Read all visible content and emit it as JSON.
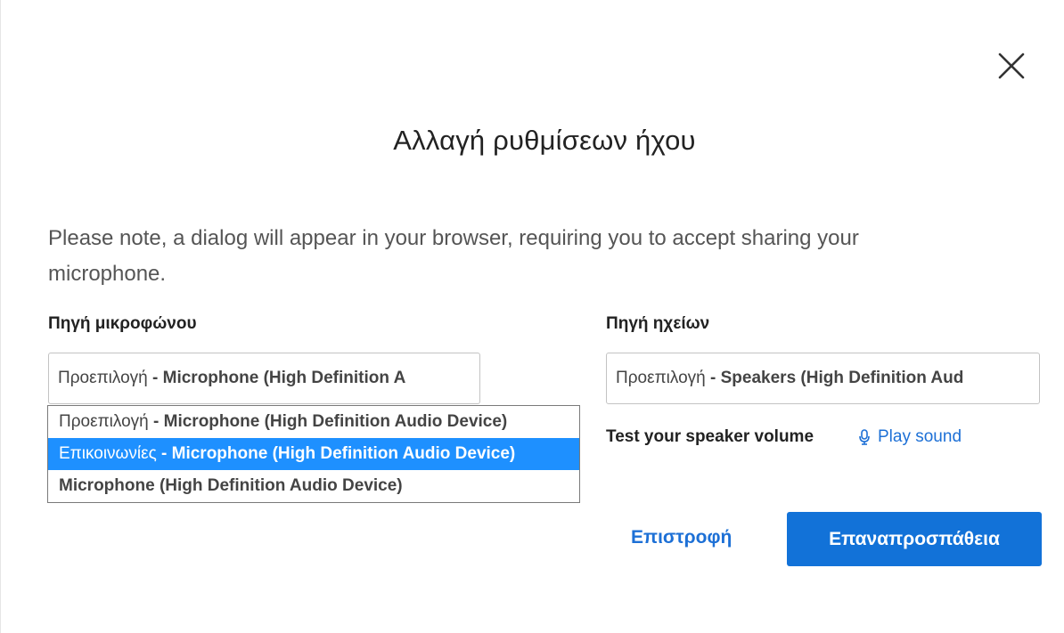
{
  "dialog": {
    "title": "Αλλαγή ρυθμίσεων ήχου",
    "note": "Please note, a dialog will appear in your browser, requiring you to accept sharing your microphone."
  },
  "microphone": {
    "label": "Πηγή μικροφώνου",
    "selected_prefix": "Προεπιλογή",
    "selected_device": " - Microphone (High Definition A",
    "options": [
      {
        "prefix": "Προεπιλογή",
        "device": " - Microphone (High Definition Audio Device)"
      },
      {
        "prefix": "Επικοινωνίες",
        "device": " - Microphone (High Definition Audio Device)"
      },
      {
        "prefix": "",
        "device": "Microphone (High Definition Audio Device)"
      }
    ]
  },
  "speaker": {
    "label": "Πηγή ηχείων",
    "selected_prefix": "Προεπιλογή",
    "selected_device": " - Speakers (High Definition Aud",
    "test_label": "Test your speaker volume",
    "play_label": "Play sound"
  },
  "actions": {
    "back_label": "Επιστροφή",
    "retry_label": "Επαναπροσπάθεια"
  },
  "colors": {
    "accent": "#1272d8",
    "link": "#1d70d6",
    "highlight": "#1e90ff"
  },
  "icons": {
    "close": "close-icon",
    "play": "microphone-icon"
  }
}
